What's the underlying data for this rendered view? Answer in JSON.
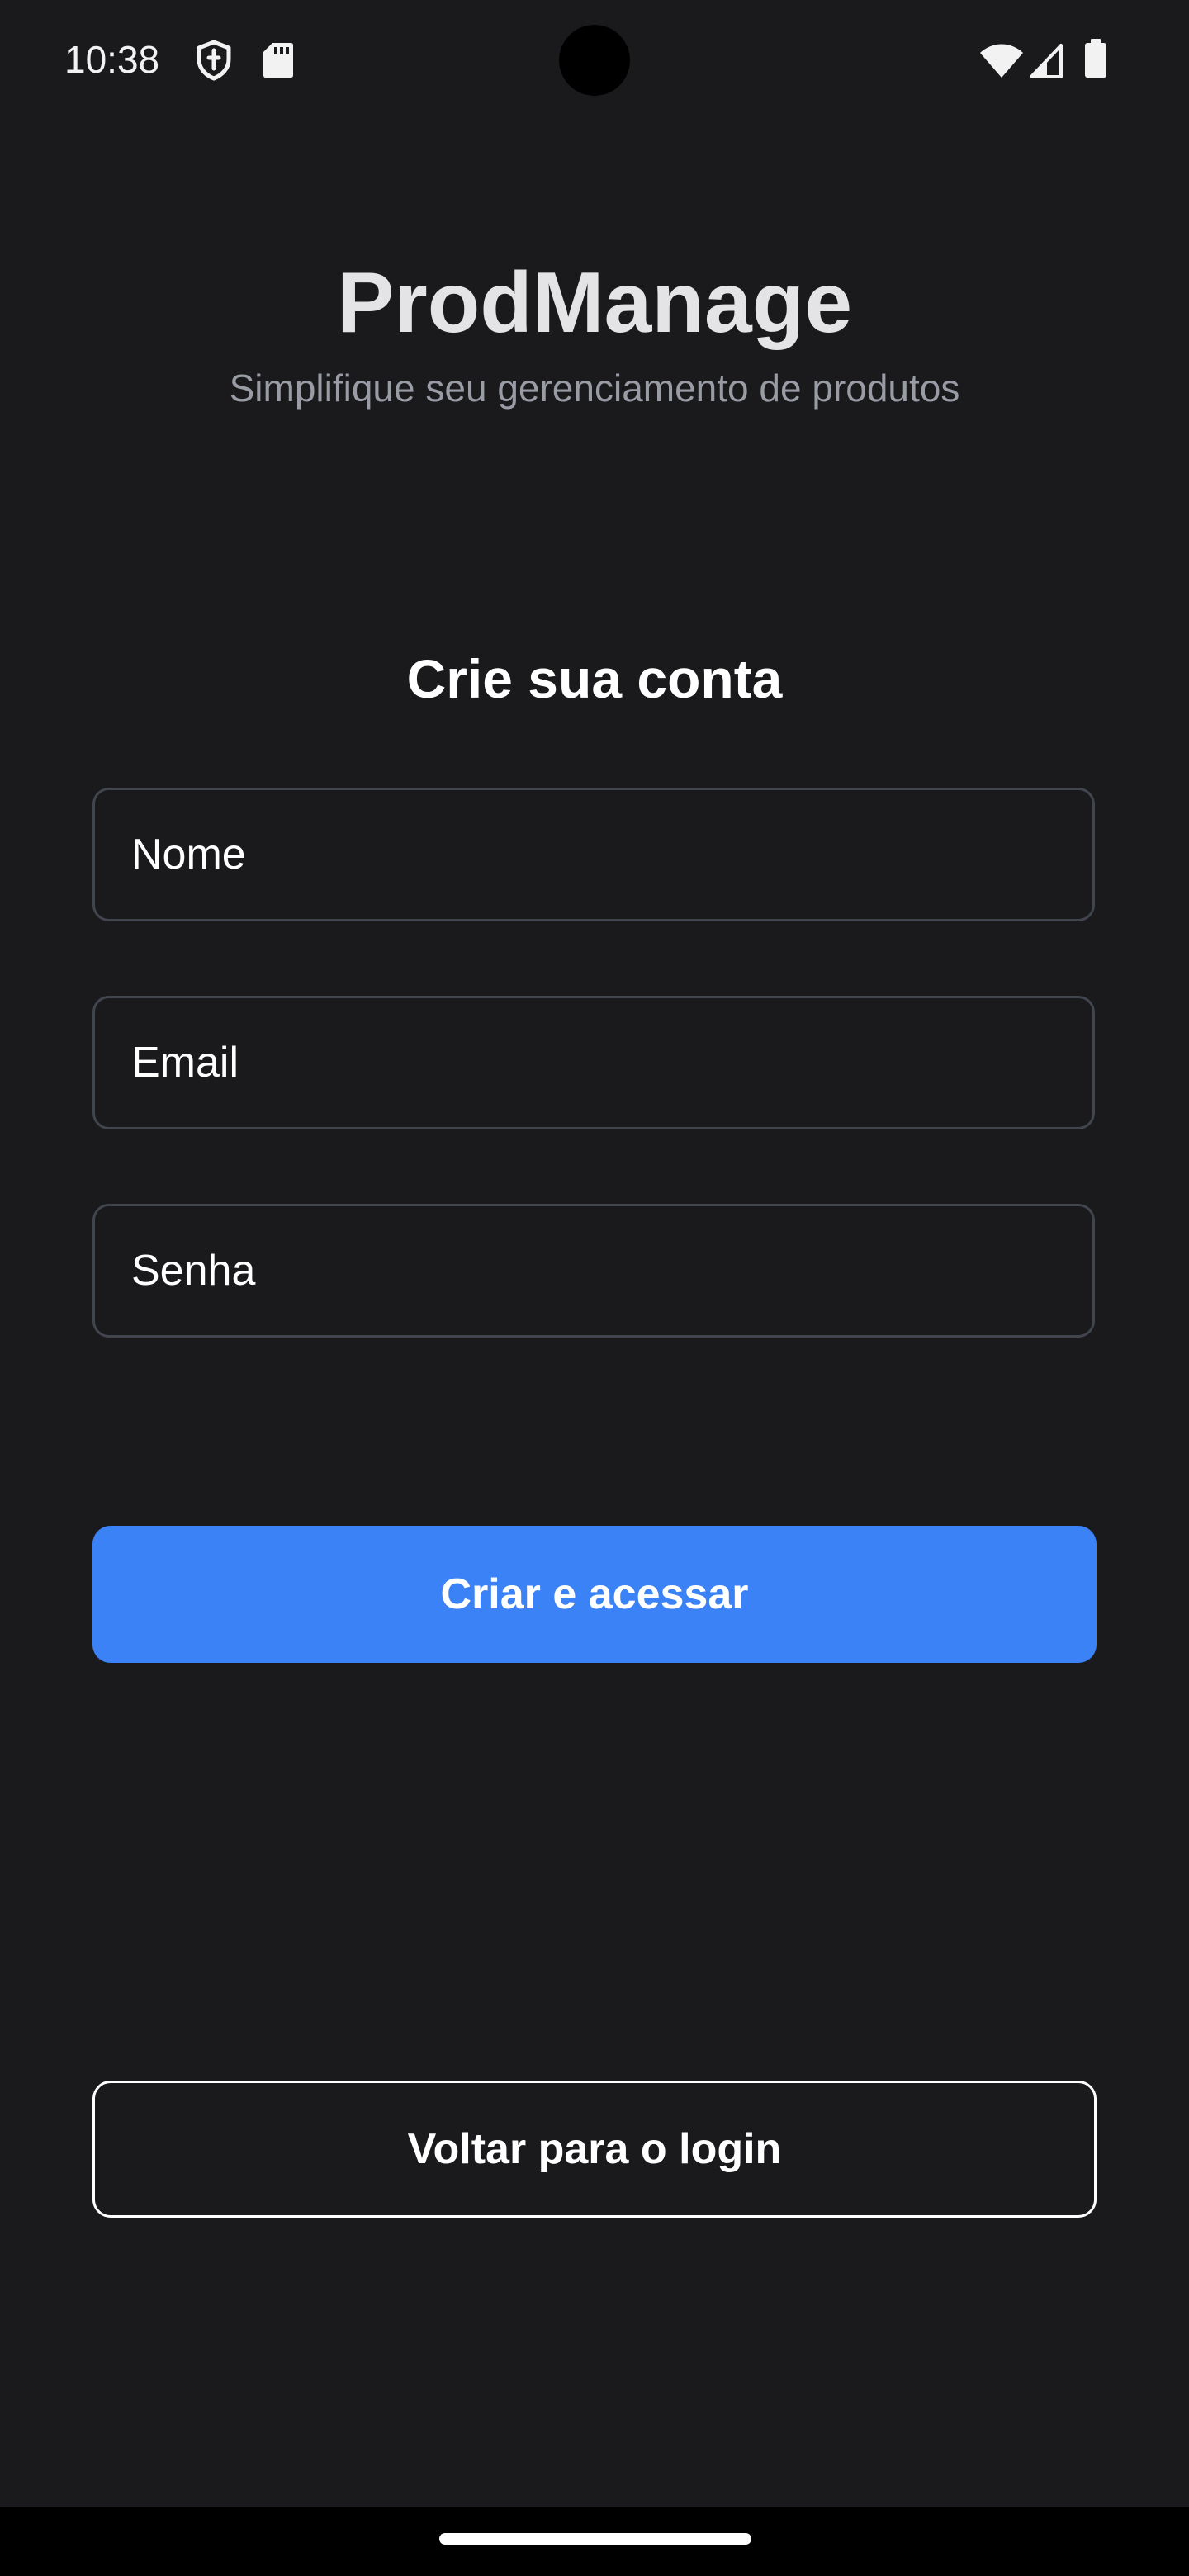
{
  "status_bar": {
    "time": "10:38",
    "left_icons": [
      "shield-icon",
      "sd-card-icon"
    ],
    "right_icons": [
      "wifi-icon",
      "signal-icon",
      "battery-icon"
    ]
  },
  "header": {
    "title": "ProdManage",
    "subtitle": "Simplifique seu gerenciamento de produtos"
  },
  "form": {
    "title": "Crie sua conta",
    "fields": [
      {
        "placeholder": "Nome",
        "value": ""
      },
      {
        "placeholder": "Email",
        "value": ""
      },
      {
        "placeholder": "Senha",
        "value": ""
      }
    ],
    "submit_label": "Criar e acessar",
    "back_label": "Voltar para o login"
  },
  "colors": {
    "background": "#1a1a1d",
    "primary": "#3b82f6",
    "field_border": "#41454e",
    "subtitle": "#9a9ca5"
  }
}
